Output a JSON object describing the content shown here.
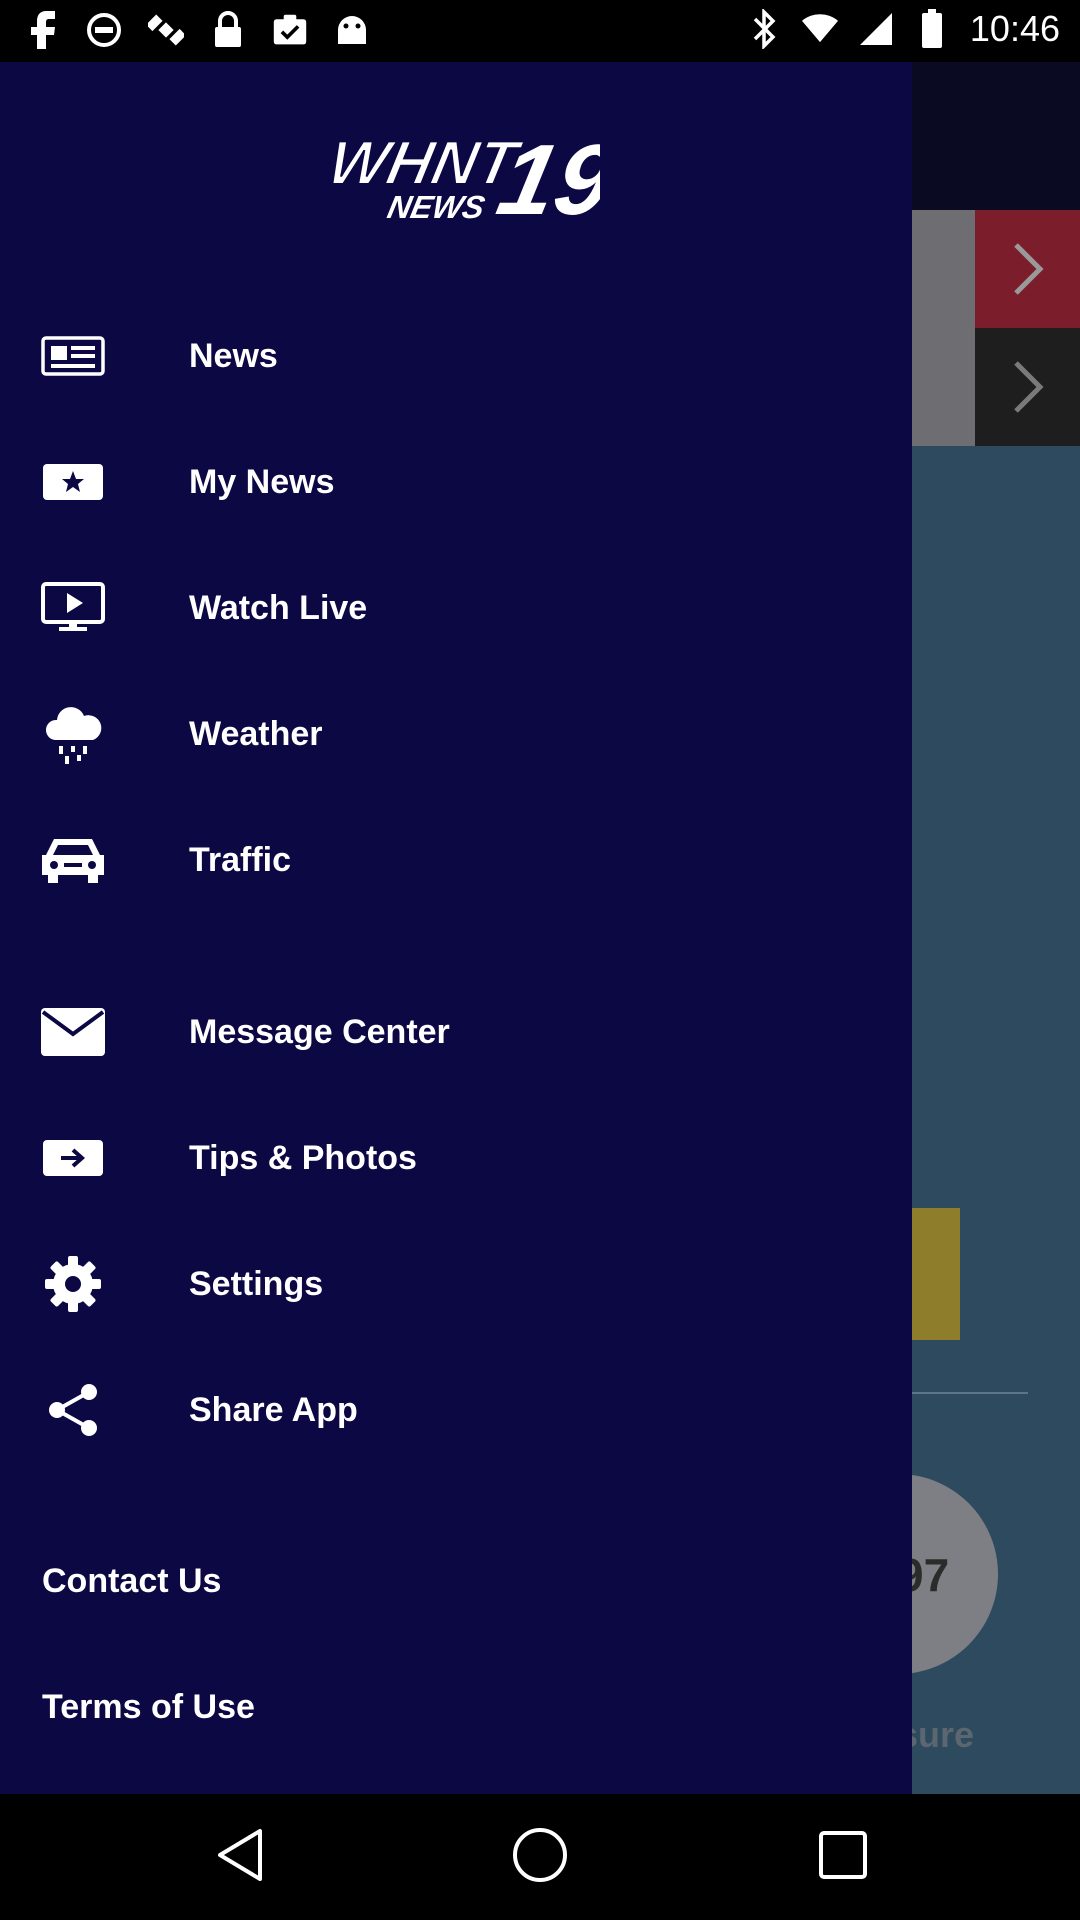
{
  "status_bar": {
    "time": "10:46",
    "left_icons": [
      "facebook-icon",
      "circle-blocked-icon",
      "satellite-icon",
      "lock-icon",
      "clipboard-check-icon",
      "android-icon"
    ],
    "right_icons": [
      "bluetooth-icon",
      "wifi-icon",
      "signal-icon",
      "battery-icon"
    ]
  },
  "drawer": {
    "logo_text": "WHNT 19 NEWS",
    "menu": [
      {
        "label": "News",
        "icon": "newspaper-icon"
      },
      {
        "label": "My News",
        "icon": "star-card-icon"
      },
      {
        "label": "Watch Live",
        "icon": "tv-play-icon"
      },
      {
        "label": "Weather",
        "icon": "rain-cloud-icon"
      },
      {
        "label": "Traffic",
        "icon": "car-icon"
      },
      {
        "label": "Message Center",
        "icon": "envelope-icon"
      },
      {
        "label": "Tips & Photos",
        "icon": "share-card-icon"
      },
      {
        "label": "Settings",
        "icon": "gear-icon"
      },
      {
        "label": "Share App",
        "icon": "share-icon"
      }
    ],
    "footer": [
      {
        "label": "Contact Us"
      },
      {
        "label": "Terms of Use"
      }
    ]
  },
  "background": {
    "number_fragment": "97",
    "word_fragment": "sure"
  },
  "colors": {
    "drawer_bg": "#0c0844",
    "accent_red": "#7c1d2c",
    "background_app": "#2e4a5e"
  },
  "nav_bar": {
    "buttons": [
      "back-icon",
      "home-icon",
      "recents-icon"
    ]
  }
}
